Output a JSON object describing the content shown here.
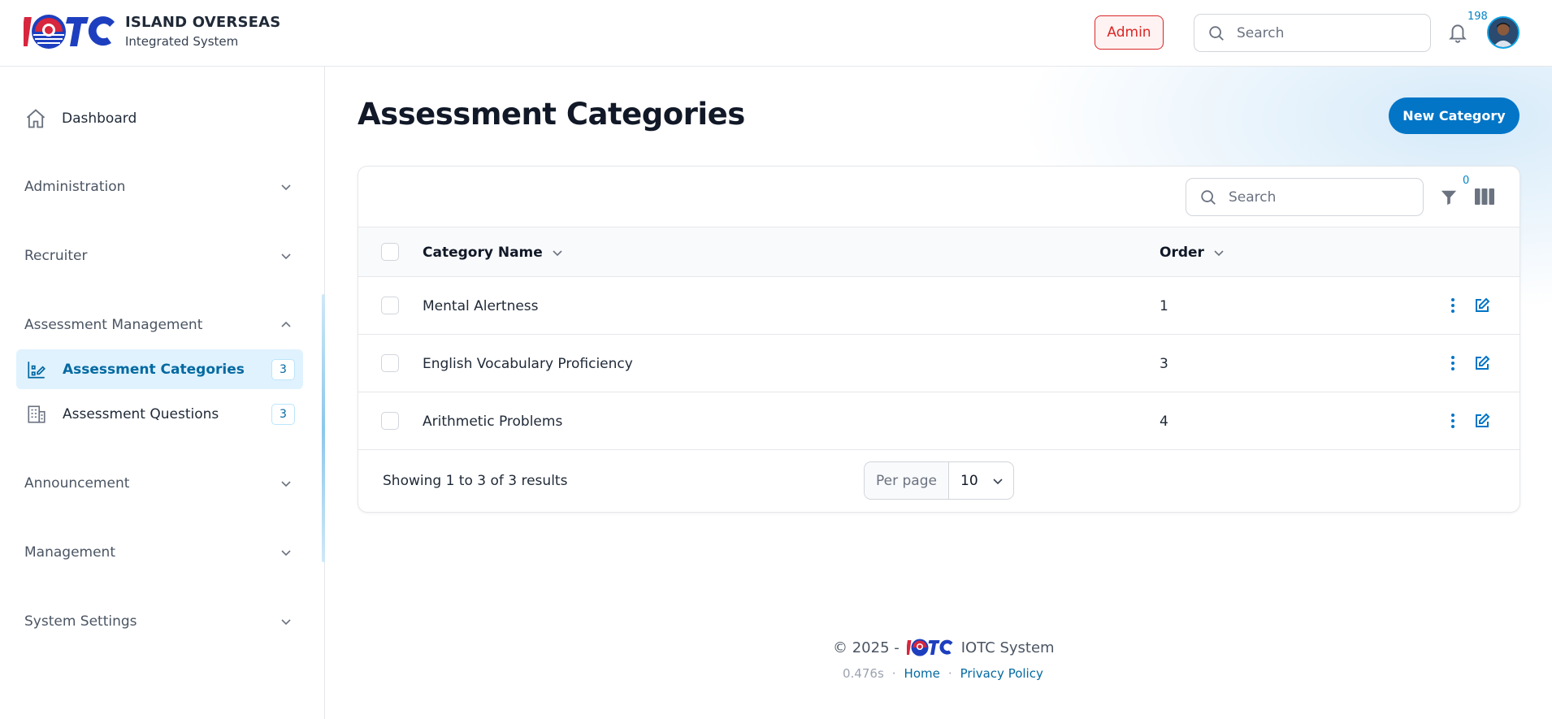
{
  "header": {
    "brand_title": "ISLAND OVERSEAS",
    "brand_subtitle": "Integrated System",
    "role_badge": "Admin",
    "search_placeholder": "Search",
    "notification_count": "198"
  },
  "sidebar": {
    "dashboard_label": "Dashboard",
    "groups": [
      {
        "label": "Administration"
      },
      {
        "label": "Recruiter"
      },
      {
        "label": "Assessment Management"
      },
      {
        "label": "Announcement"
      },
      {
        "label": "Management"
      },
      {
        "label": "System Settings"
      }
    ],
    "sub_items": [
      {
        "label": "Assessment Categories",
        "count": "3",
        "active": true
      },
      {
        "label": "Assessment Questions",
        "count": "3",
        "active": false
      }
    ]
  },
  "main": {
    "page_title": "Assessment Categories",
    "new_button": "New Category",
    "table_search_placeholder": "Search",
    "filter_count": "0",
    "columns": {
      "name": "Category Name",
      "order": "Order"
    },
    "rows": [
      {
        "name": "Mental Alertness",
        "order": "1"
      },
      {
        "name": "English Vocabulary Proficiency",
        "order": "3"
      },
      {
        "name": "Arithmetic Problems",
        "order": "4"
      }
    ],
    "showing_text": "Showing 1 to 3 of 3 results",
    "per_page_label": "Per page",
    "per_page_value": "10"
  },
  "footer": {
    "copyright": "© 2025 -",
    "system_name": "IOTC System",
    "render_time": "0.476s",
    "home_link": "Home",
    "privacy_link": "Privacy Policy"
  },
  "colors": {
    "accent": "#0275c7",
    "admin_badge": "#dc2626",
    "active_bg": "#e0f2fe"
  },
  "icons": [
    "home-icon",
    "chevron-down-icon",
    "chevron-up-icon",
    "categories-icon",
    "questions-icon",
    "search-icon",
    "bell-icon",
    "filter-icon",
    "columns-icon",
    "more-vertical-icon",
    "edit-icon"
  ]
}
